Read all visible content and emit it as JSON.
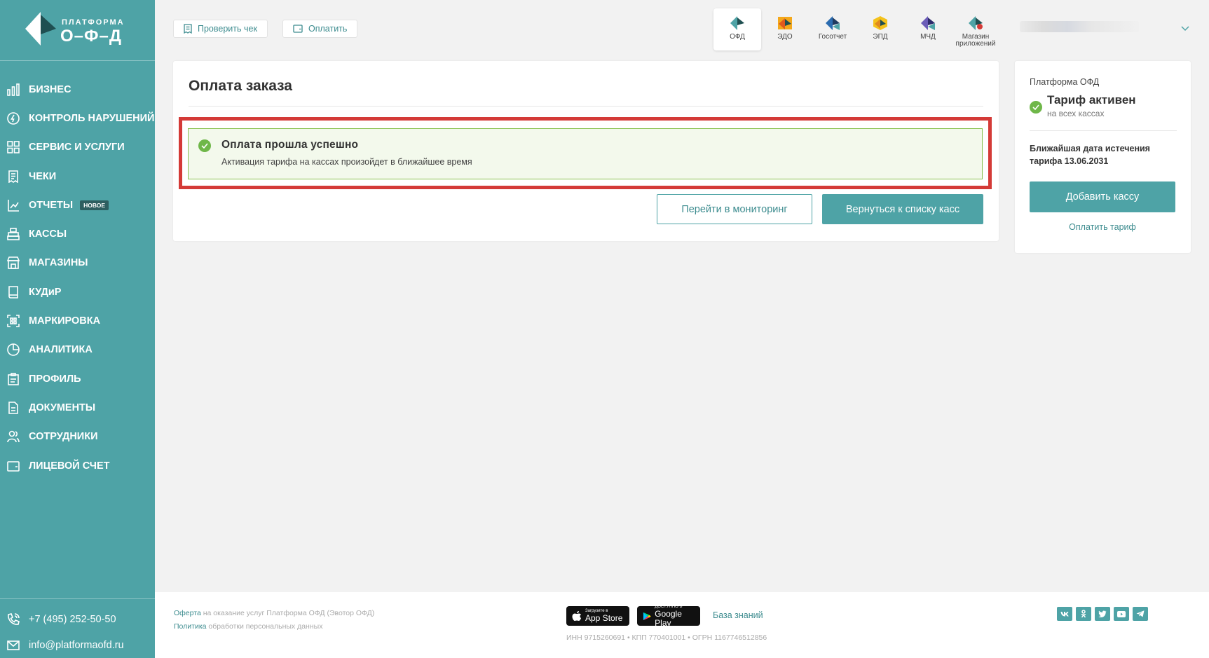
{
  "logo": {
    "top": "ПЛАТФОРМА",
    "main": "О–Ф–Д"
  },
  "sidebar": {
    "items": [
      {
        "label": "БИЗНЕС"
      },
      {
        "label": "КОНТРОЛЬ НАРУШЕНИЙ"
      },
      {
        "label": "СЕРВИС И УСЛУГИ"
      },
      {
        "label": "ЧЕКИ"
      },
      {
        "label": "ОТЧЕТЫ",
        "badge": "НОВОЕ"
      },
      {
        "label": "КАССЫ"
      },
      {
        "label": "МАГАЗИНЫ"
      },
      {
        "label": "КУДиР"
      },
      {
        "label": "МАРКИРОВКА"
      },
      {
        "label": "АНАЛИТИКА"
      },
      {
        "label": "ПРОФИЛЬ"
      },
      {
        "label": "ДОКУМЕНТЫ"
      },
      {
        "label": "СОТРУДНИКИ"
      },
      {
        "label": "ЛИЦЕВОЙ СЧЕТ"
      }
    ],
    "phone": "+7 (495) 252-50-50",
    "email": "info@platformaofd.ru"
  },
  "topbar": {
    "check_receipt": "Проверить чек",
    "pay": "Оплатить",
    "apps": [
      {
        "label": "ОФД"
      },
      {
        "label": "ЭДО"
      },
      {
        "label": "Госотчет"
      },
      {
        "label": "ЭПД"
      },
      {
        "label": "МЧД"
      },
      {
        "label": "Магазин приложений"
      }
    ]
  },
  "main": {
    "title": "Оплата заказа",
    "success_title": "Оплата прошла успешно",
    "success_text": "Активация тарифа на кассах произойдет в ближайшее время",
    "btn_monitoring": "Перейти в мониторинг",
    "btn_back": "Вернуться к списку касс"
  },
  "tariff": {
    "provider": "Платформа ОФД",
    "status": "Тариф активен",
    "sub": "на всех кассах",
    "expiry": "Ближайшая дата истечения тарифа 13.06.2031",
    "add_button": "Добавить кассу",
    "pay_link": "Оплатить тариф"
  },
  "footer": {
    "offer_link": "Оферта",
    "offer_text": " на оказание услуг Платформа ОФД (Эвотор ОФД)",
    "policy_link": "Политика",
    "policy_text": " обработки персональных данных",
    "appstore_small": "Загрузите в",
    "appstore_big": "App Store",
    "gplay_small": "ДОСТУПНО В",
    "gplay_big": "Google Play",
    "knowledge_base": "База знаний",
    "requisites": "ИНН 9715260691  •  КПП 770401001  •  ОГРН 1167746512856",
    "socials": [
      "vk",
      "ok",
      "twitter",
      "youtube",
      "telegram"
    ]
  },
  "colors": {
    "accent": "#4ea3a6",
    "success": "#6fb749",
    "highlight": "#d43a37"
  }
}
